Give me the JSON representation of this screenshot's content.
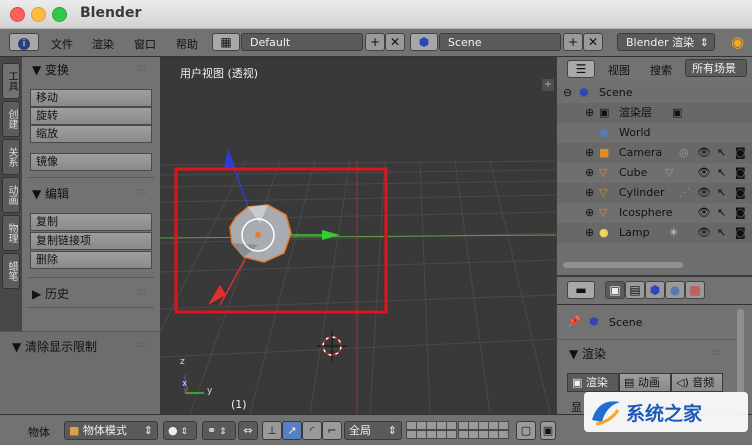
{
  "window": {
    "title": "Blender"
  },
  "info_header": {
    "menus": [
      "文件",
      "渲染",
      "窗口",
      "帮助"
    ],
    "screen_layout": "Default",
    "scene": "Scene",
    "render_engine": "Blender 渲染"
  },
  "tool_tabs": [
    "工具",
    "创建",
    "关系",
    "动画",
    "物理",
    "蜡笔"
  ],
  "tool_shelf": {
    "transform": {
      "header": "▼ 变换",
      "buttons": [
        "移动",
        "旋转",
        "缩放"
      ],
      "mirror": "镜像"
    },
    "edit": {
      "header": "▼ 编辑",
      "buttons": [
        "复制",
        "复制链接项",
        "删除"
      ]
    },
    "history": {
      "header": "▶ 历史"
    },
    "clear_limit": "▼ 清除显示限制"
  },
  "viewport": {
    "label": "用户视图 (透视)",
    "frame": "(1)",
    "axes": {
      "x": "x",
      "y": "y",
      "z": "z"
    }
  },
  "outliner": {
    "view_menu": "视图",
    "search_menu": "搜索",
    "filter": "所有场景",
    "items": [
      {
        "label": "Scene",
        "icon": "scene-icon"
      },
      {
        "label": "渲染层",
        "icon": "render-layer-icon"
      },
      {
        "label": "World",
        "icon": "world-icon"
      },
      {
        "label": "Camera",
        "icon": "camera-icon"
      },
      {
        "label": "Cube",
        "icon": "mesh-icon"
      },
      {
        "label": "Cylinder",
        "icon": "mesh-icon"
      },
      {
        "label": "Icosphere",
        "icon": "mesh-icon"
      },
      {
        "label": "Lamp",
        "icon": "lamp-icon"
      }
    ]
  },
  "properties": {
    "context": "Scene",
    "panel_header": "▼ 渲染",
    "tabs": [
      "渲染",
      "动画",
      "音频"
    ],
    "partial_label": "显"
  },
  "bottom_bar": {
    "menu": "物体",
    "mode": "物体模式",
    "global": "全局"
  },
  "watermark": {
    "text": "系统之家"
  },
  "colors": {
    "selection_box": "#e0141c",
    "x_axis": "#d42b2b",
    "y_axis": "#22c322",
    "z_axis": "#2a3fd6",
    "header_gray": "#727272",
    "viewport_bg": "#393939"
  }
}
